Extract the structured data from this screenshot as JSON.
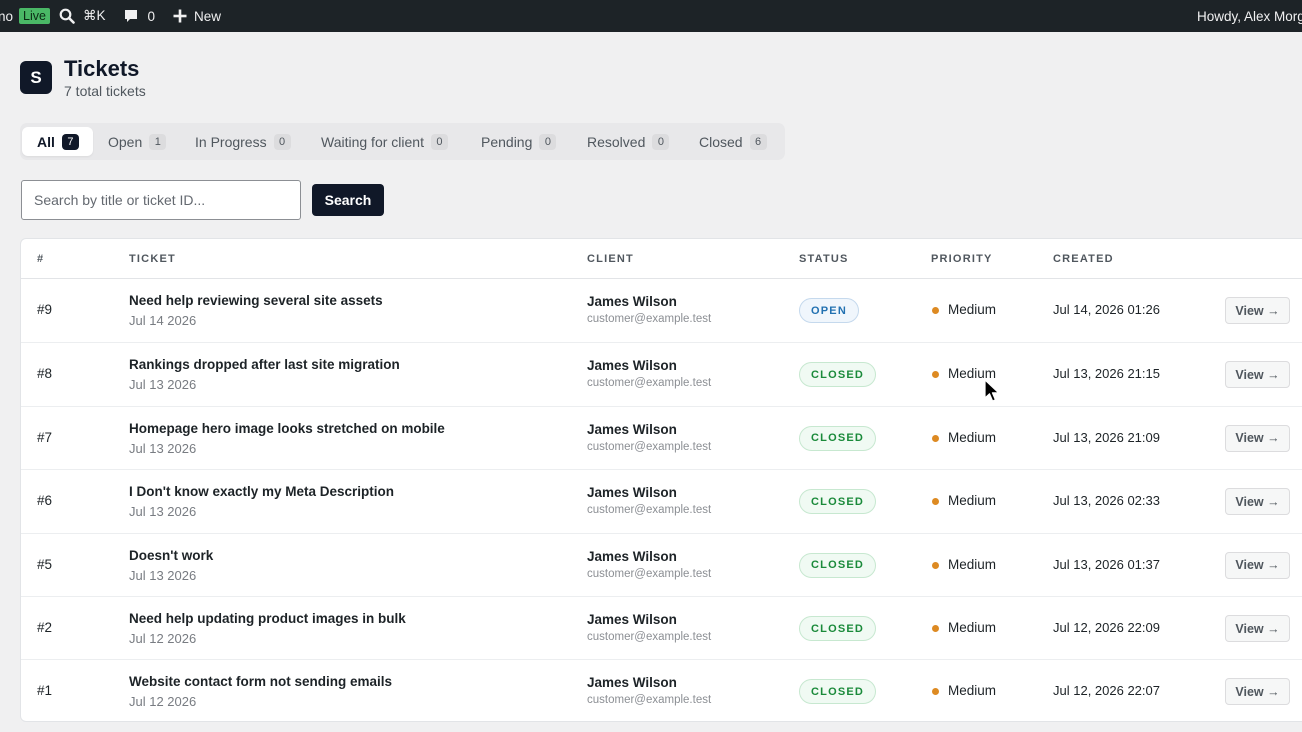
{
  "adminbar": {
    "site_label": "no",
    "live_label": "Live",
    "shortcut_label": "⌘K",
    "comments_count": "0",
    "new_label": "New",
    "howdy": "Howdy, Alex Morg"
  },
  "header": {
    "logo_letter": "S",
    "title": "Tickets",
    "subtitle": "7 total tickets"
  },
  "tabs": [
    {
      "label": "All",
      "count": "7"
    },
    {
      "label": "Open",
      "count": "1"
    },
    {
      "label": "In Progress",
      "count": "0"
    },
    {
      "label": "Waiting for client",
      "count": "0"
    },
    {
      "label": "Pending",
      "count": "0"
    },
    {
      "label": "Resolved",
      "count": "0"
    },
    {
      "label": "Closed",
      "count": "6"
    }
  ],
  "search": {
    "placeholder": "Search by title or ticket ID...",
    "value": "",
    "button_label": "Search"
  },
  "table": {
    "columns": [
      "#",
      "Ticket",
      "Client",
      "Status",
      "Priority",
      "Created"
    ],
    "view_label": "View →",
    "rows": [
      {
        "id": "#9",
        "title": "Need help reviewing several site assets",
        "date": "Jul 14 2026",
        "client_name": "James Wilson",
        "client_email": "customer@example.test",
        "status": "OPEN",
        "priority": "Medium",
        "created": "Jul 14, 2026 01:26"
      },
      {
        "id": "#8",
        "title": "Rankings dropped after last site migration",
        "date": "Jul 13 2026",
        "client_name": "James Wilson",
        "client_email": "customer@example.test",
        "status": "CLOSED",
        "priority": "Medium",
        "created": "Jul 13, 2026 21:15"
      },
      {
        "id": "#7",
        "title": "Homepage hero image looks stretched on mobile",
        "date": "Jul 13 2026",
        "client_name": "James Wilson",
        "client_email": "customer@example.test",
        "status": "CLOSED",
        "priority": "Medium",
        "created": "Jul 13, 2026 21:09"
      },
      {
        "id": "#6",
        "title": "I Don't know exactly my Meta Description",
        "date": "Jul 13 2026",
        "client_name": "James Wilson",
        "client_email": "customer@example.test",
        "status": "CLOSED",
        "priority": "Medium",
        "created": "Jul 13, 2026 02:33"
      },
      {
        "id": "#5",
        "title": "Doesn't work",
        "date": "Jul 13 2026",
        "client_name": "James Wilson",
        "client_email": "customer@example.test",
        "status": "CLOSED",
        "priority": "Medium",
        "created": "Jul 13, 2026 01:37"
      },
      {
        "id": "#2",
        "title": "Need help updating product images in bulk",
        "date": "Jul 12 2026",
        "client_name": "James Wilson",
        "client_email": "customer@example.test",
        "status": "CLOSED",
        "priority": "Medium",
        "created": "Jul 12, 2026 22:09"
      },
      {
        "id": "#1",
        "title": "Website contact form not sending emails",
        "date": "Jul 12 2026",
        "client_name": "James Wilson",
        "client_email": "customer@example.test",
        "status": "CLOSED",
        "priority": "Medium",
        "created": "Jul 12, 2026 22:07"
      }
    ]
  },
  "colors": {
    "adminbar_bg": "#1d2327",
    "live_badge": "#4ab866",
    "primary": "#101828",
    "open_status": "#2271b1",
    "closed_status": "#1a8a3a",
    "priority_medium": "#dd8a22"
  },
  "icons": {
    "search": "search-icon",
    "comments": "comment-icon",
    "new": "plus-icon",
    "cursor": "mouse-pointer-icon"
  }
}
